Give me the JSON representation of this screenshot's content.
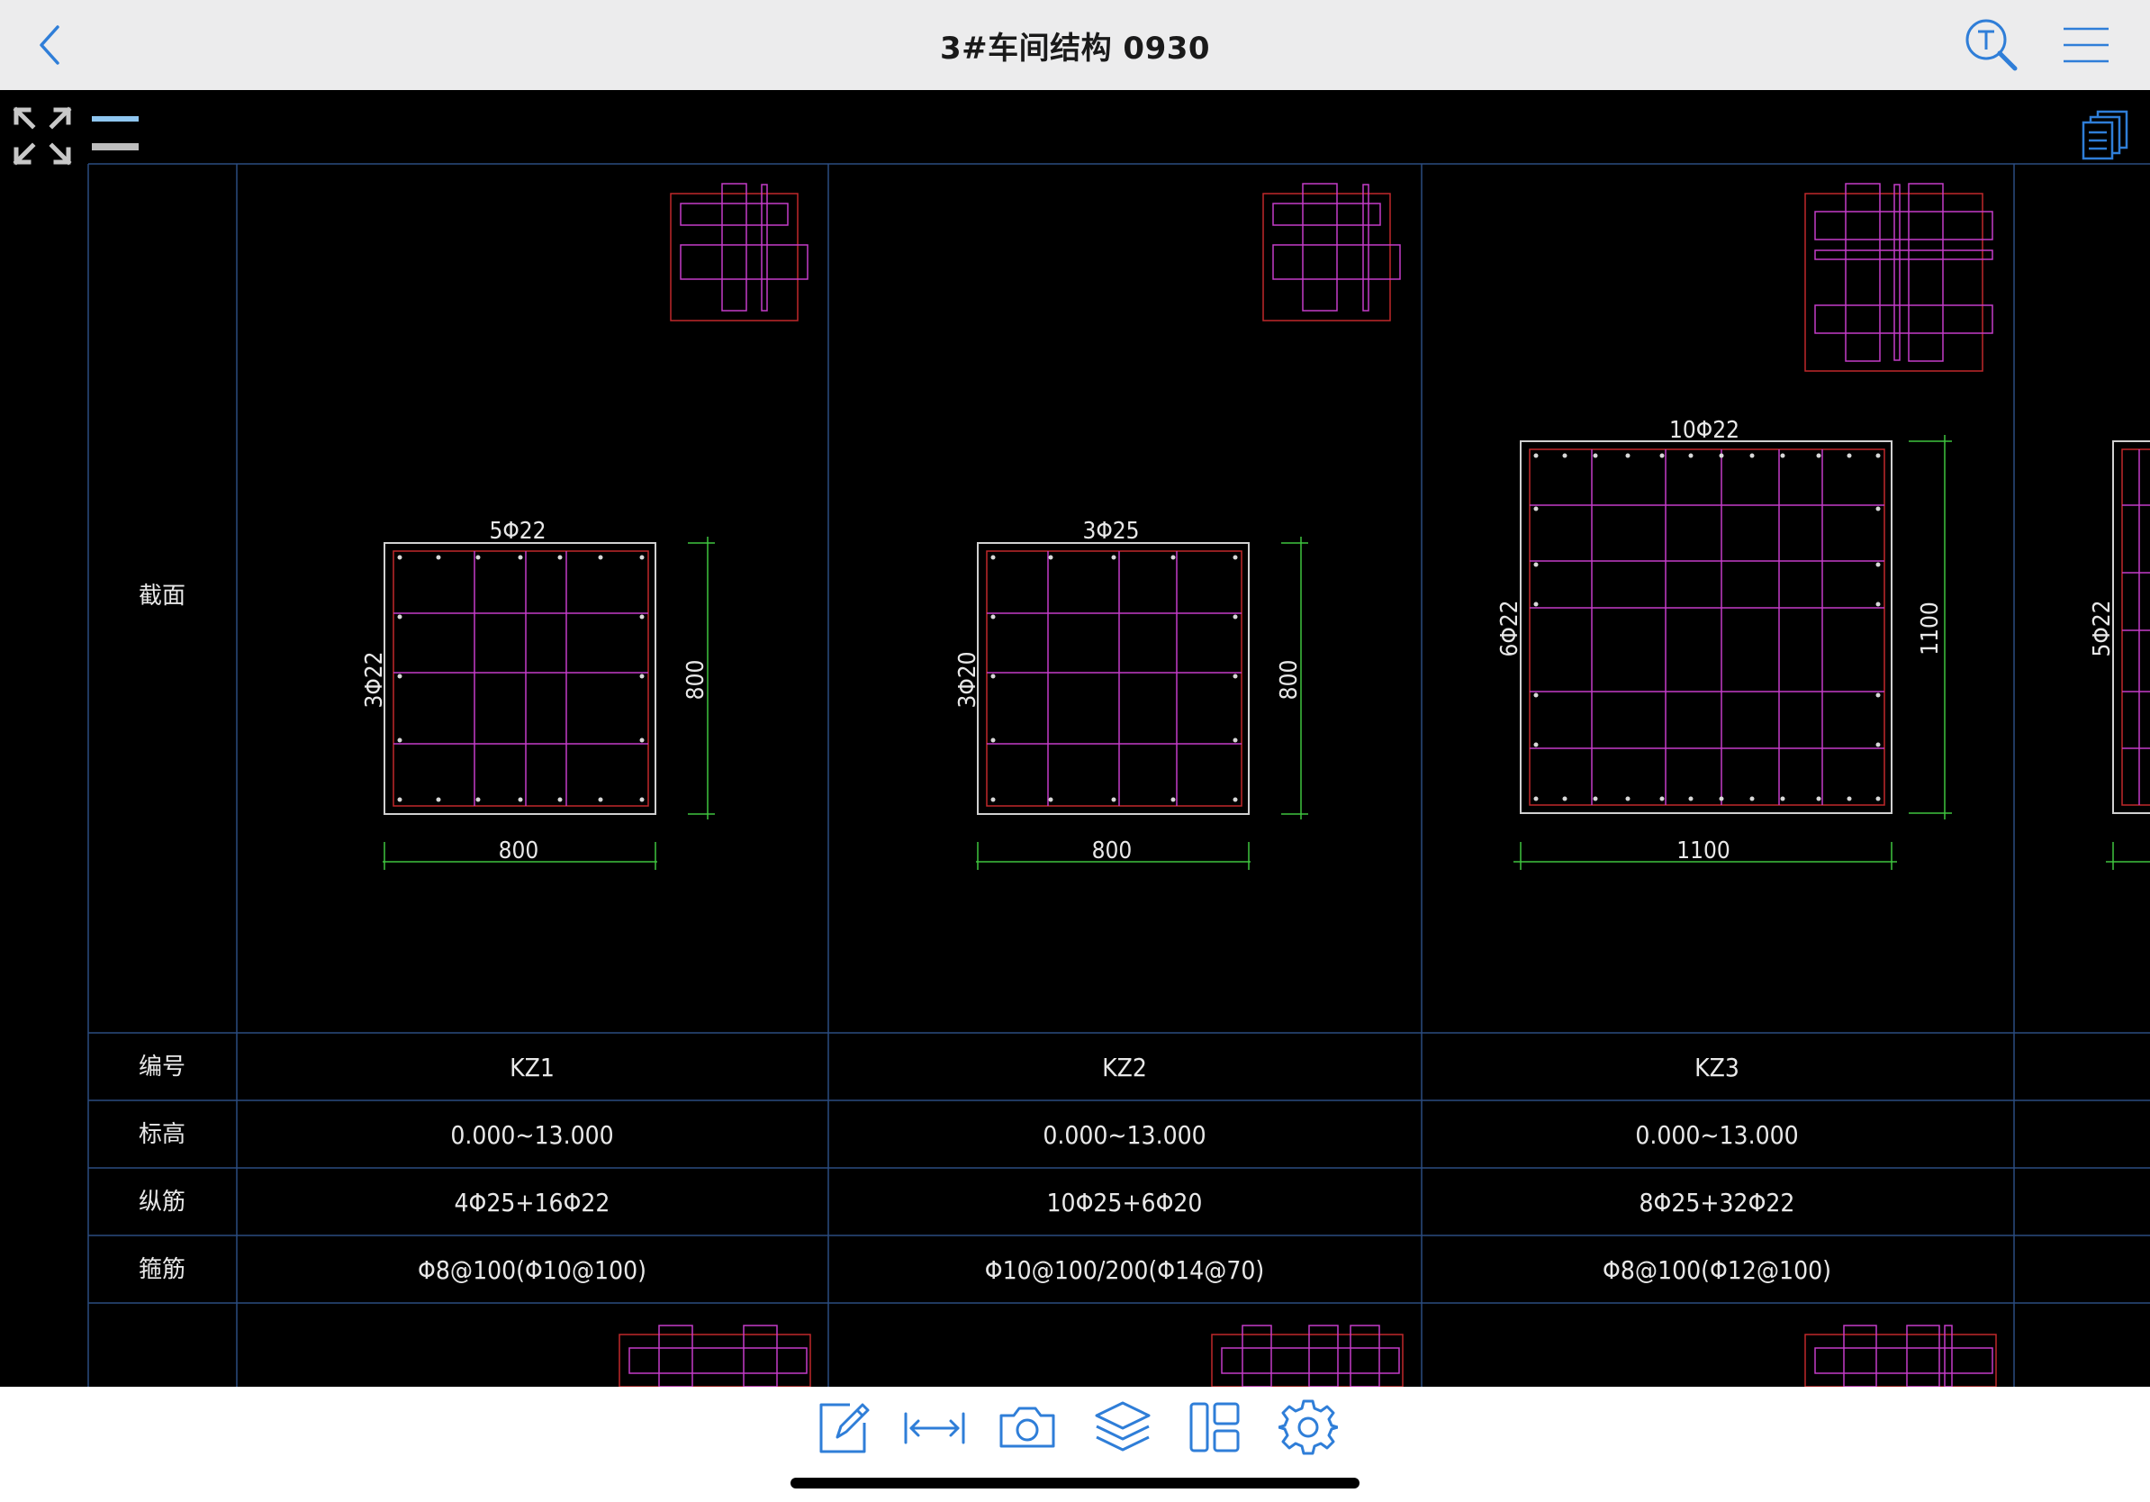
{
  "app": {
    "title": "3#车间结构 0930",
    "accent_color": "#2f7ed8"
  },
  "toolbar_top": {
    "back_icon": "chevron-left-icon",
    "text_search_icon": "text-search-icon",
    "menu_icon": "hamburger-menu-icon"
  },
  "canvas_tools": {
    "fullscreen_icon": "expand-arrows-icon",
    "layer_toggle_icon": "two-lines-icon",
    "sheets_icon": "stacked-pages-icon"
  },
  "bottom_toolbar": {
    "items": [
      {
        "name": "annotate",
        "icon": "pencil-note-icon"
      },
      {
        "name": "measure",
        "icon": "dimension-arrows-icon"
      },
      {
        "name": "screenshot",
        "icon": "camera-icon"
      },
      {
        "name": "layers",
        "icon": "layers-icon"
      },
      {
        "name": "layout",
        "icon": "layout-panels-icon"
      },
      {
        "name": "settings",
        "icon": "gear-icon"
      }
    ]
  },
  "drawing": {
    "row_headers": {
      "section": "截面",
      "id": "编号",
      "elevation": "标高",
      "longitudinal": "纵筋",
      "stirrup": "箍筋"
    },
    "columns": [
      {
        "id": "KZ1",
        "elevation": "0.000~13.000",
        "longitudinal": "4Φ25+16Φ22",
        "stirrup": "Φ8@100(Φ10@100)",
        "top_bars": "5Φ22",
        "side_bars": "3Φ22",
        "width_dim": "800",
        "height_dim": "800"
      },
      {
        "id": "KZ2",
        "elevation": "0.000~13.000",
        "longitudinal": "10Φ25+6Φ20",
        "stirrup": "Φ10@100/200(Φ14@70)",
        "top_bars": "3Φ25",
        "side_bars": "3Φ20",
        "width_dim": "800",
        "height_dim": "800"
      },
      {
        "id": "KZ3",
        "elevation": "0.000~13.000",
        "longitudinal": "8Φ25+32Φ22",
        "stirrup": "Φ8@100(Φ12@100)",
        "top_bars": "10Φ22",
        "side_bars": "6Φ22",
        "width_dim": "1100",
        "height_dim": "1100"
      }
    ],
    "partial_column_side_bars": "5Φ22"
  }
}
